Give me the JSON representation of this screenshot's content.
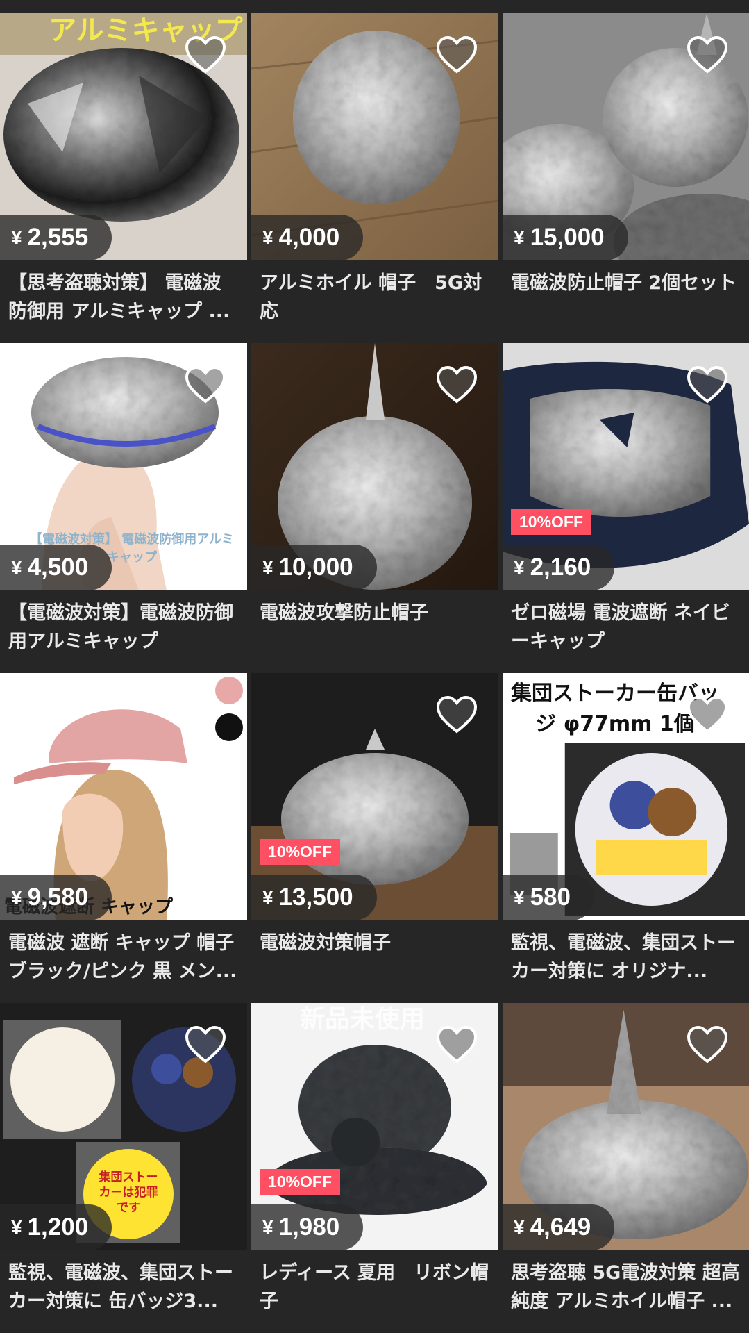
{
  "products": [
    {
      "price": "2,555",
      "currency": "¥",
      "title": "【思考盗聴対策】 電磁波防御用 アルミキャップ ...",
      "image_text": "アルミキャップ",
      "badge": ""
    },
    {
      "price": "4,000",
      "currency": "¥",
      "title": "アルミホイル 帽子　5G対応",
      "image_text": "",
      "badge": ""
    },
    {
      "price": "15,000",
      "currency": "¥",
      "title": "電磁波防止帽子 2個セット",
      "image_text": "",
      "badge": ""
    },
    {
      "price": "4,500",
      "currency": "¥",
      "title": "【電磁波対策】電磁波防御用アルミキャップ",
      "image_text": "【電磁波対策】 電磁波防御用アルミキャップ",
      "badge": ""
    },
    {
      "price": "10,000",
      "currency": "¥",
      "title": "電磁波攻撃防止帽子",
      "image_text": "",
      "badge": ""
    },
    {
      "price": "2,160",
      "currency": "¥",
      "title": "ゼロ磁場 電波遮断 ネイビーキャップ",
      "image_text": "",
      "badge": "10%OFF"
    },
    {
      "price": "9,580",
      "currency": "¥",
      "title": "電磁波 遮断 キャップ 帽子 ブラック/ピンク 黒 メン...",
      "image_text": "電磁波遮断 キャップ",
      "badge": ""
    },
    {
      "price": "13,500",
      "currency": "¥",
      "title": "電磁波対策帽子",
      "image_text": "",
      "badge": "10%OFF"
    },
    {
      "price": "580",
      "currency": "¥",
      "title": "監視、電磁波、集団ストーカー対策に オリジナ...",
      "image_text": "集団ストーカー缶バッジ φ77mm 1個",
      "badge": ""
    },
    {
      "price": "1,200",
      "currency": "¥",
      "title": "監視、電磁波、集団ストーカー対策に 缶バッジ3...",
      "image_text": "集団ストーカーは犯罪です",
      "badge": ""
    },
    {
      "price": "1,980",
      "currency": "¥",
      "title": "レディース 夏用　リボン帽子",
      "image_text": "新品未使用",
      "badge": "10%OFF"
    },
    {
      "price": "4,649",
      "currency": "¥",
      "title": "思考盗聴 5G電波対策 超高純度 アルミホイル帽子 ...",
      "image_text": "",
      "badge": ""
    }
  ],
  "icons": {
    "like": "heart-outline-icon"
  },
  "colors": {
    "background": "#262626",
    "badge": "#ff4f63",
    "price_text": "#ffffff"
  }
}
